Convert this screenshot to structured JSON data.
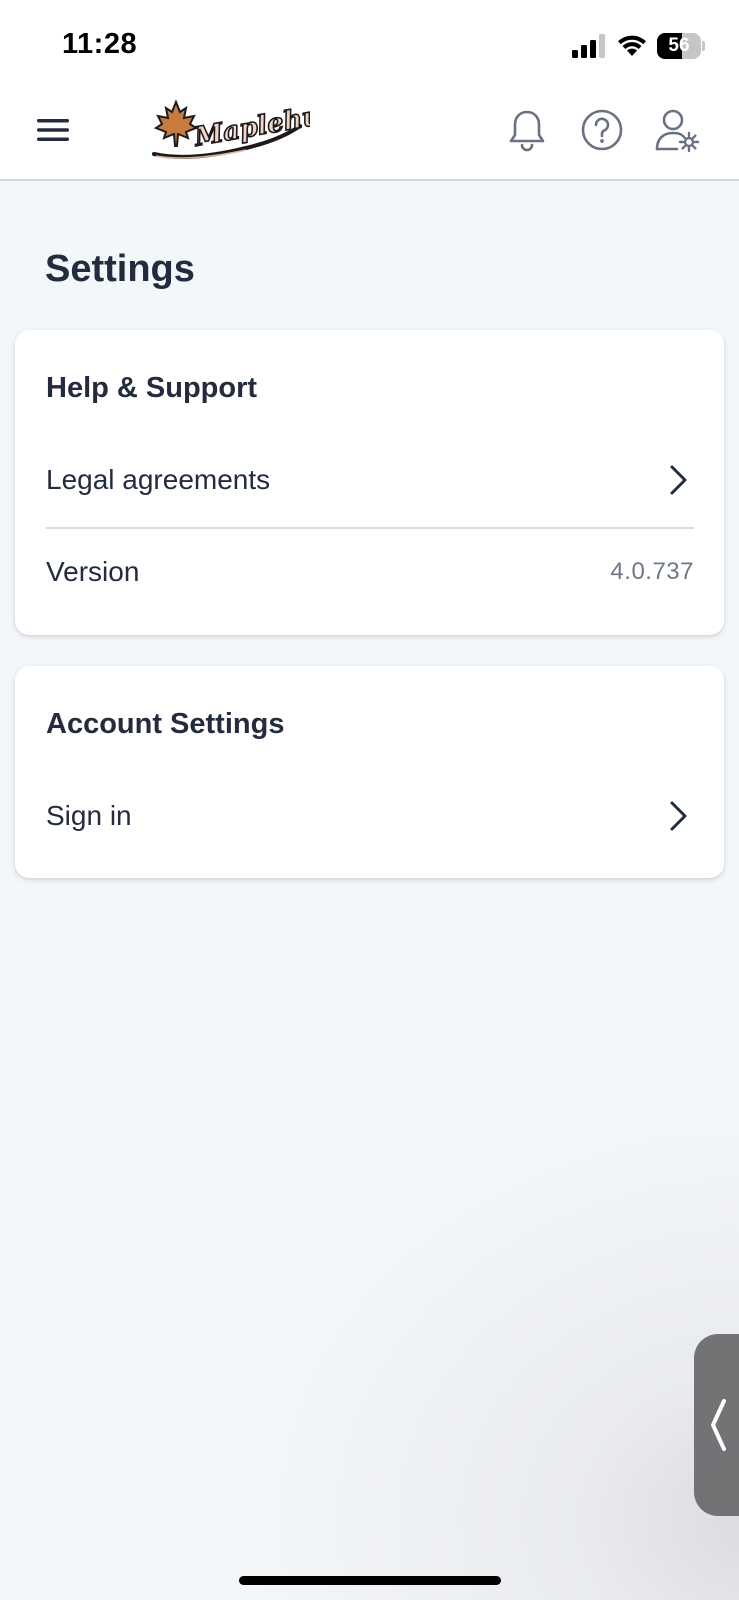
{
  "status_bar": {
    "time": "11:28",
    "battery_percent": "56",
    "battery_level": 0.56
  },
  "header": {
    "logo_text": "Maplehurst",
    "icons": [
      "menu-icon",
      "bell-icon",
      "help-icon",
      "account-settings-icon"
    ]
  },
  "page": {
    "title": "Settings"
  },
  "help_support": {
    "heading": "Help & Support",
    "legal_label": "Legal agreements",
    "version_label": "Version",
    "version_value": "4.0.737"
  },
  "account_settings": {
    "heading": "Account Settings",
    "sign_in_label": "Sign in"
  },
  "colors": {
    "text": "#232c3f",
    "muted": "#6f7787",
    "background": "#f4f7fa",
    "logo_accent": "#c87a3f"
  }
}
